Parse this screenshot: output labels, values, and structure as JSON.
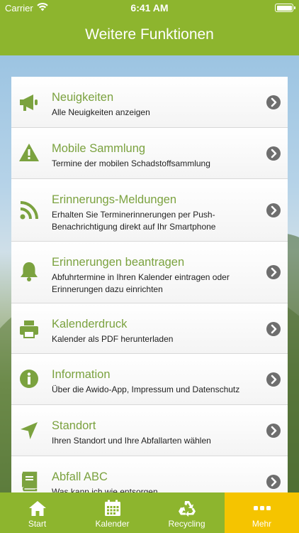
{
  "status_bar": {
    "carrier": "Carrier",
    "time": "6:41 AM"
  },
  "header": {
    "title": "Weitere Funktionen"
  },
  "menu": [
    {
      "title": "Neuigkeiten",
      "subtitle": "Alle Neuigkeiten anzeigen",
      "icon": "megaphone-icon"
    },
    {
      "title": "Mobile Sammlung",
      "subtitle": "Termine der mobilen Schadstoffsammlung",
      "icon": "warning-icon"
    },
    {
      "title": "Erinnerungs-Meldungen",
      "subtitle": "Erhalten Sie Terminerinnerungen per Push-Benachrichtigung direkt auf Ihr Smartphone",
      "icon": "rss-icon"
    },
    {
      "title": "Erinnerungen beantragen",
      "subtitle": "Abfuhrtermine in Ihren Kalender eintragen oder Erinnerungen dazu einrichten",
      "icon": "bell-icon"
    },
    {
      "title": "Kalenderdruck",
      "subtitle": "Kalender als PDF herunterladen",
      "icon": "printer-icon"
    },
    {
      "title": "Information",
      "subtitle": "Über die Awido-App, Impressum und Datenschutz",
      "icon": "info-icon"
    },
    {
      "title": "Standort",
      "subtitle": "Ihren Standort und Ihre Abfallarten wählen",
      "icon": "location-arrow-icon"
    },
    {
      "title": "Abfall ABC",
      "subtitle": "Was kann ich wie entsorgen",
      "icon": "book-icon"
    }
  ],
  "tabs": [
    {
      "label": "Start",
      "icon": "home-icon"
    },
    {
      "label": "Kalender",
      "icon": "calendar-icon"
    },
    {
      "label": "Recycling",
      "icon": "recycling-icon"
    },
    {
      "label": "Mehr",
      "icon": "more-icon",
      "active": true
    }
  ],
  "colors": {
    "accent_green": "#8db52e",
    "title_green": "#7ba23f",
    "active_tab": "#f5c400"
  }
}
